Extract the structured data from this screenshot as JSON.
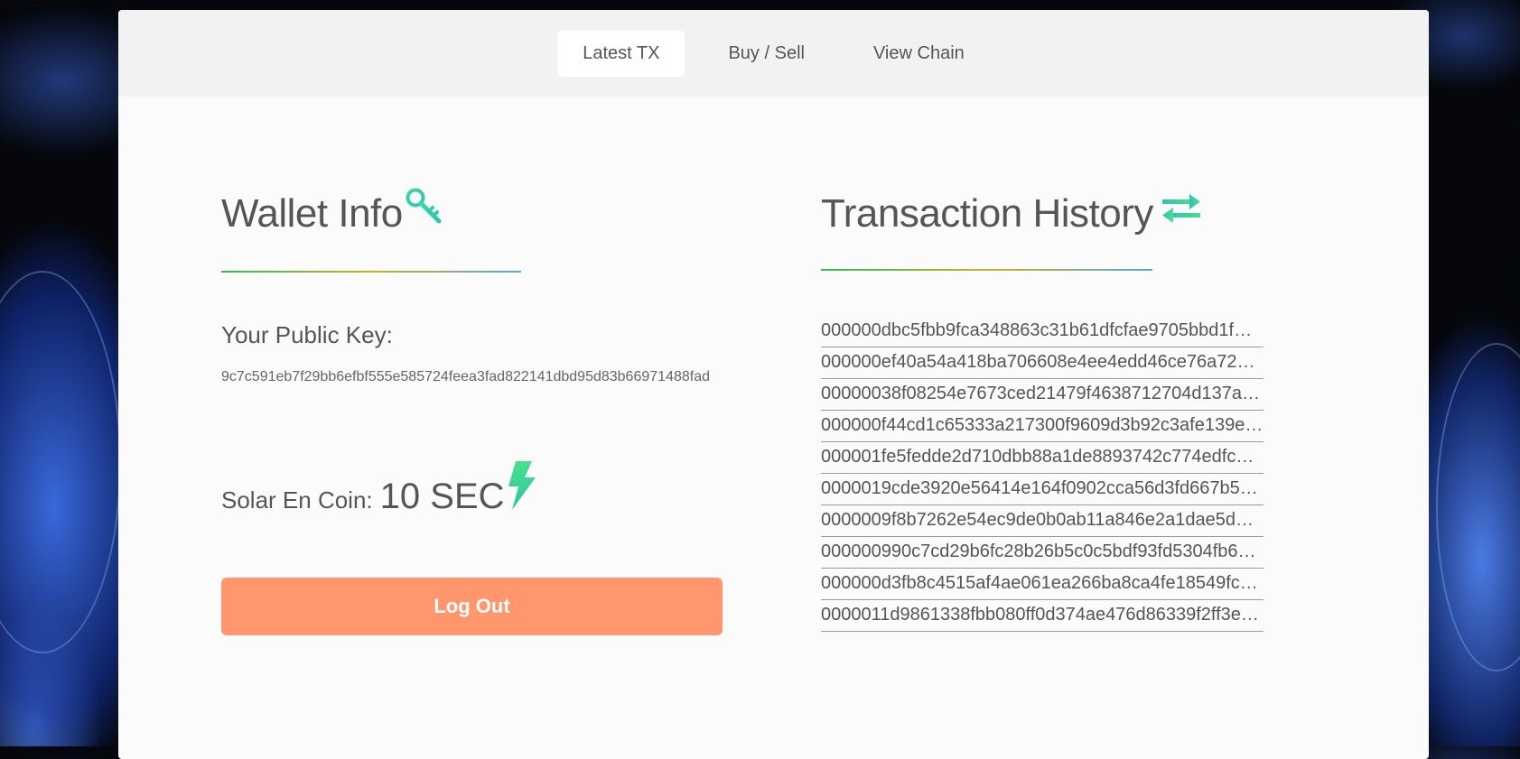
{
  "nav": {
    "tabs": [
      {
        "label": "Latest TX",
        "active": true
      },
      {
        "label": "Buy / Sell",
        "active": false
      },
      {
        "label": "View Chain",
        "active": false
      }
    ]
  },
  "wallet": {
    "title": "Wallet Info",
    "title_icon": "key-icon",
    "public_key_label": "Your Public Key:",
    "public_key": "9c7c591eb7f29bb6efbf555e585724feea3fad822141dbd95d83b66971488fad",
    "coin_label": "Solar En Coin:",
    "coin_value": "10 SEC",
    "coin_icon": "lightning-icon",
    "logout_label": "Log Out"
  },
  "history": {
    "title": "Transaction History",
    "title_icon": "exchange-arrows-icon",
    "transactions": [
      "000000dbc5fbb9fca348863c31b61dfcfae9705bbd1f…",
      "000000ef40a54a418ba706608e4ee4edd46ce76a722…",
      "00000038f08254e7673ced21479f4638712704d137a…",
      "000000f44cd1c65333a217300f9609d3b92c3afe139e…",
      "000001fe5fedde2d710dbb88a1de8893742c774edfc…",
      "0000019cde3920e56414e164f0902cca56d3fd667b5…",
      "0000009f8b7262e54ec9de0b0ab11a846e2a1dae5d…",
      "000000990c7cd29b6fc28b26b5c0c5bdf93fd5304fb6…",
      "000000d3fb8c4515af4ae061ea266ba8ca4fe18549fc…",
      "0000011d9861338fbb080ff0d374ae476d86339f2ff3e…"
    ]
  },
  "colors": {
    "accent_green": "#3dd68c",
    "logout_button": "#ff966d",
    "gradient": [
      "#2ebd5a",
      "#c8b321",
      "#5aa8d8"
    ]
  }
}
